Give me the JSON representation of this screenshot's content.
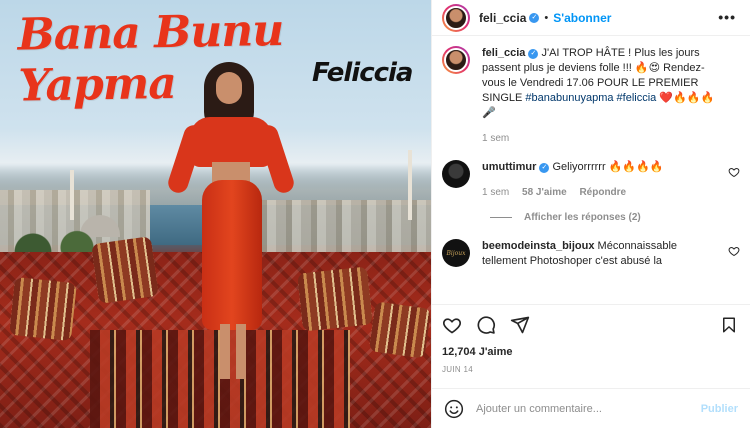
{
  "media": {
    "title_text": "Bana Bunu Yapma",
    "subtitle_text": "Feliccia"
  },
  "header": {
    "username": "feli_ccia",
    "verified_mark": "✓",
    "separator": "•",
    "follow_label": "S'abonner",
    "more_icon": "more-horizontal-icon",
    "more_glyph": "•••"
  },
  "caption": {
    "username": "feli_ccia",
    "verified_mark": "✓",
    "text_1": " J'AI TROP HÂTE ! Plus les jours passent plus je deviens folle !!! 🔥😍 Rendez-vous le Vendredi 17.06 POUR LE PREMIER SINGLE ",
    "hashtag_1": "#banabunuyapma",
    "space": " ",
    "hashtag_2": "#feliccia",
    "emojis": " ❤️🔥🔥🔥🎤",
    "time": "1 sem"
  },
  "comments": [
    {
      "username": "umuttimur",
      "verified_mark": "✓",
      "text": " Geliyorrrrrr 🔥🔥🔥🔥",
      "time": "1 sem",
      "likes": "58 J'aime",
      "reply_label": "Répondre",
      "view_replies": "Afficher les réponses (2)"
    },
    {
      "username": "beemodeinsta_bijoux",
      "text": " Méconnaissable tellement Photoshoper c'est abusé la",
      "avatar_label": "Bijoux"
    }
  ],
  "actions": {
    "like_icon": "heart-icon",
    "comment_icon": "comment-icon",
    "share_icon": "send-icon",
    "save_icon": "bookmark-icon"
  },
  "likes_text": "12,704 J'aime",
  "date_text": "JUIN 14",
  "composer": {
    "placeholder": "Ajouter un commentaire...",
    "publish_label": "Publier",
    "emoji_icon": "smiley-icon"
  },
  "colors": {
    "accent": "#0095f6",
    "verified": "#3897f0",
    "muted": "#8e8e8e",
    "hashtag": "#00376b",
    "title_red": "#e8341b"
  }
}
